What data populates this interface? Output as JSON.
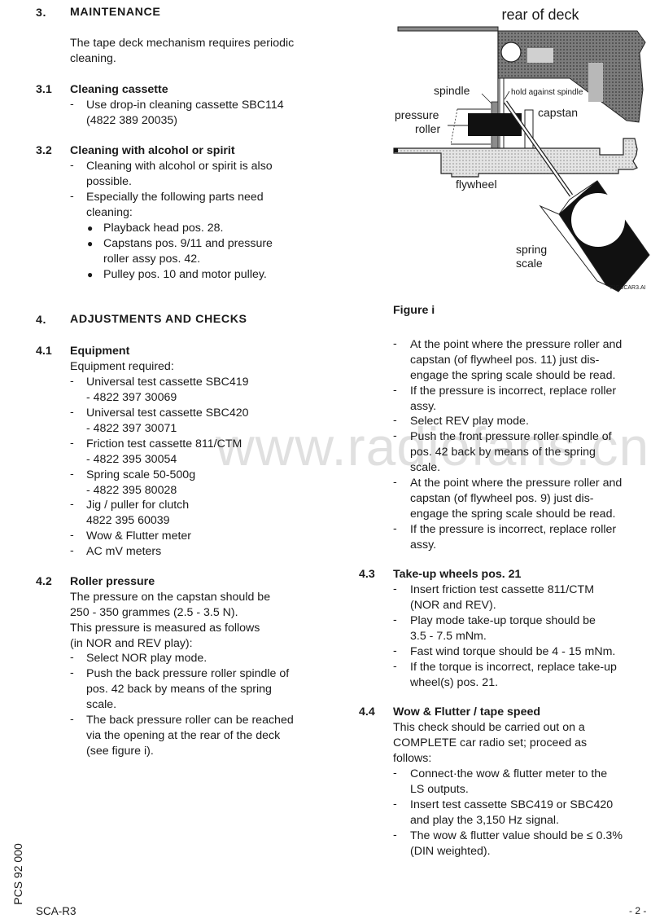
{
  "left": {
    "s3": {
      "num": "3.",
      "title": "MAINTENANCE",
      "intro": [
        "The tape deck mechanism requires periodic",
        "cleaning."
      ]
    },
    "s31": {
      "num": "3.1",
      "title": "Cleaning cassette",
      "items": [
        [
          "Use drop-in cleaning cassette SBC114",
          "(4822 389 20035)"
        ]
      ]
    },
    "s32": {
      "num": "3.2",
      "title": "Cleaning with alcohol or spirit",
      "items": [
        [
          "Cleaning with alcohol or spirit is also",
          "possible."
        ],
        [
          "Especially the following parts need",
          "cleaning:"
        ]
      ],
      "bullets": [
        [
          "Playback head pos. 28."
        ],
        [
          "Capstans pos. 9/11 and pressure",
          "roller assy pos. 42."
        ],
        [
          "Pulley pos. 10 and motor pulley."
        ]
      ]
    },
    "s4": {
      "num": "4.",
      "title": "ADJUSTMENTS AND CHECKS"
    },
    "s41": {
      "num": "4.1",
      "title": "Equipment",
      "intro": "Equipment required:",
      "items": [
        [
          "Universal test cassette SBC419",
          "- 4822 397 30069"
        ],
        [
          "Universal test cassette SBC420",
          "- 4822 397 30071"
        ],
        [
          "Friction test cassette 811/CTM",
          "- 4822 395 30054"
        ],
        [
          "Spring scale 50-500g",
          "- 4822 395 80028"
        ],
        [
          "Jig / puller for clutch",
          "4822 395 60039"
        ],
        [
          "Wow & Flutter meter"
        ],
        [
          "AC mV meters"
        ]
      ]
    },
    "s42": {
      "num": "4.2",
      "title": "Roller pressure",
      "intro": [
        "The pressure on the capstan should be",
        "250 - 350 grammes (2.5 - 3.5 N).",
        "This pressure is measured as follows",
        "(in NOR and REV play):"
      ],
      "items": [
        [
          "Select NOR play mode."
        ],
        [
          "Push the back pressure roller spindle of",
          "pos. 42 back by means of the spring",
          "scale."
        ],
        [
          "The back pressure roller can be reached",
          "via the opening at the rear of the deck",
          "(see figure i)."
        ]
      ]
    }
  },
  "figure": {
    "title": "rear of deck",
    "labels": {
      "spindle": "spindle",
      "hold": "hold against spindle",
      "pressure": "pressure",
      "roller": "roller",
      "capstan": "capstan",
      "flywheel": "flywheel",
      "spring": "spring",
      "scale": "scale",
      "file": "FIGSCAR3.AI"
    },
    "caption": "Figure i"
  },
  "right": {
    "cont_items": [
      [
        "At the point where the pressure roller and",
        "capstan (of flywheel pos. 11) just dis-",
        "engage the spring scale should be read."
      ],
      [
        "If the pressure is incorrect, replace roller",
        "assy."
      ],
      [
        "Select REV play mode."
      ],
      [
        "Push the front pressure roller spindle of",
        "pos. 42 back by means of the spring",
        "scale."
      ],
      [
        "At the point where the pressure roller and",
        "capstan (of flywheel pos. 9) just dis-",
        "engage the spring scale should be read."
      ],
      [
        "If the pressure is incorrect, replace roller",
        "assy."
      ]
    ],
    "s43": {
      "num": "4.3",
      "title": "Take-up wheels pos. 21",
      "items": [
        [
          "Insert friction test cassette 811/CTM",
          "(NOR and REV)."
        ],
        [
          "Play mode take-up torque should be",
          "3.5 - 7.5 mNm."
        ],
        [
          "Fast wind torque should be 4 - 15 mNm."
        ],
        [
          "If the torque is incorrect, replace take-up",
          "wheel(s) pos. 21."
        ]
      ]
    },
    "s44": {
      "num": "4.4",
      "title": "Wow & Flutter / tape speed",
      "intro": [
        "This check should be carried out on a",
        "COMPLETE car radio set; proceed as",
        "follows:"
      ],
      "items": [
        [
          "Connect·the wow & flutter meter to the",
          "LS outputs."
        ],
        [
          "Insert test cassette SBC419 or SBC420",
          "and play the 3,150 Hz signal."
        ],
        [
          "The wow & flutter value should be ≤ 0.3%",
          "(DIN weighted)."
        ]
      ]
    }
  },
  "footer": {
    "vertical": "PCS 92 000",
    "code": "SCA-R3",
    "page": "- 2 -"
  },
  "watermark": "www.radiofans.cn",
  "dash": "-",
  "bullet": "●"
}
